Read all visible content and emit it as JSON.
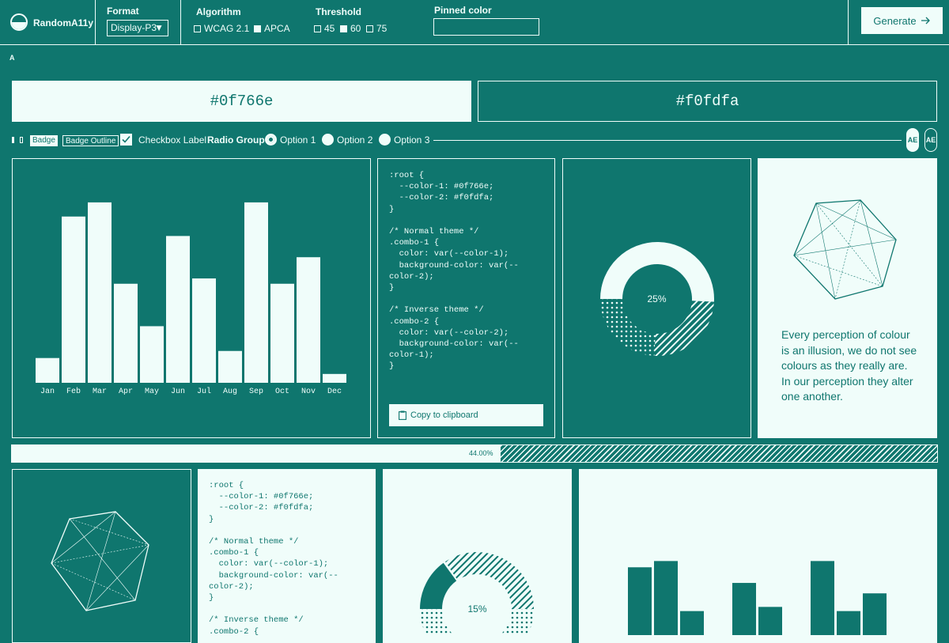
{
  "header": {
    "app_name": "RandomA11y",
    "format": {
      "label": "Format",
      "value": "Display-P3",
      "arrow": "▼"
    },
    "algorithm": {
      "label": "Algorithm",
      "options": [
        {
          "label": "WCAG 2.1",
          "checked": false
        },
        {
          "label": "APCA",
          "checked": true
        }
      ]
    },
    "threshold": {
      "label": "Threshold",
      "options": [
        {
          "label": "45",
          "checked": false
        },
        {
          "label": "60",
          "checked": true
        },
        {
          "label": "75",
          "checked": false
        }
      ]
    },
    "pinned": {
      "label": "Pinned color",
      "value": ""
    },
    "generate": {
      "label": "Generate",
      "icon": "arrow-right-icon"
    }
  },
  "small_label": "A",
  "swatches": {
    "color1": "#0f766e",
    "color2": "#f0fdfa"
  },
  "controls": {
    "badge": "Badge",
    "badge_outline": "Badge Outline",
    "checkbox_label": "Checkbox Label",
    "radio_group": "Radio Group",
    "options": [
      "Option 1",
      "Option 2",
      "Option 3"
    ],
    "selected_option": "Option 1",
    "avatar_text": "AE"
  },
  "code_text": ":root {\n  --color-1: #0f766e;\n  --color-2: #f0fdfa;\n}\n\n/* Normal theme */\n.combo-1 {\n  color: var(--color-1);\n  background-color: var(--\ncolor-2);\n}\n\n/* Inverse theme */\n.combo-2 {\n  color: var(--color-2);\n  background-color: var(--\ncolor-1);\n}",
  "code_text_2": ":root {\n  --color-1: #0f766e;\n  --color-2: #f0fdfa;\n}\n\n/* Normal theme */\n.combo-1 {\n  color: var(--color-1);\n  background-color: var(--\ncolor-2);\n}\n\n/* Inverse theme */\n.combo-2 {",
  "copy_button": "Copy to clipboard",
  "quote": "Every perception of colour is an illusion, we do not see colours as they really are. In our perception they alter one another.",
  "progress": {
    "value": 0.44,
    "label": "44.00%"
  },
  "donut1": {
    "value": 0.25,
    "label": "25%"
  },
  "donut2": {
    "value": 0.15,
    "label": "15%"
  },
  "chart_data": [
    {
      "type": "bar",
      "categories": [
        "Jan",
        "Feb",
        "Mar",
        "Apr",
        "May",
        "Jun",
        "Jul",
        "Aug",
        "Sep",
        "Oct",
        "Nov",
        "Dec"
      ],
      "values": [
        14,
        94,
        102,
        56,
        32,
        83,
        59,
        18,
        102,
        56,
        71,
        5
      ],
      "ylim": [
        0,
        110
      ],
      "grid": false
    },
    {
      "type": "bar",
      "categories": [
        "",
        "",
        "",
        "",
        "",
        "",
        "",
        "",
        "",
        ""
      ],
      "values": [
        62,
        68,
        20,
        0,
        47,
        24,
        0,
        68,
        20,
        37
      ],
      "ylim": [
        0,
        110
      ],
      "grid": false
    }
  ]
}
